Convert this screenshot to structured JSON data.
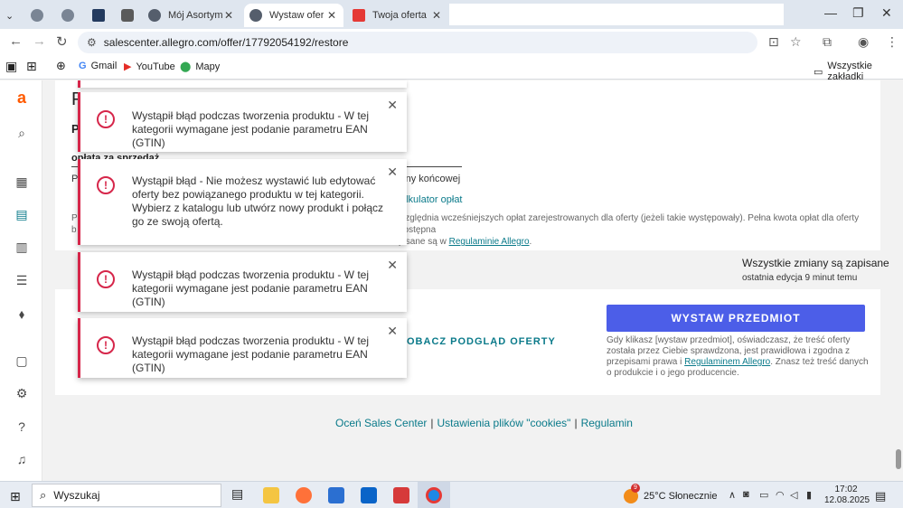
{
  "browser": {
    "tabs": [
      {
        "label": "",
        "icon": "globe-icon"
      },
      {
        "label": "",
        "icon": "globe-icon"
      },
      {
        "label": "",
        "icon": "video-icon"
      },
      {
        "label": "",
        "icon": "grey-square-icon"
      },
      {
        "label": "Mój Asortyment",
        "icon": "globe-icon"
      },
      {
        "label": "Wystaw ofertę",
        "icon": "globe-icon",
        "active": true
      },
      {
        "label": "Twoja oferta nie",
        "icon": "allegro-w-icon"
      }
    ],
    "url": "salescenter.allegro.com/offer/17792054192/restore",
    "bookmarks": [
      {
        "label": "Gmail",
        "icon": "google-icon"
      },
      {
        "label": "YouTube",
        "icon": "youtube-icon"
      },
      {
        "label": "Mapy",
        "icon": "maps-pin-icon"
      }
    ],
    "all_bookmarks": "Wszystkie zakładki"
  },
  "page": {
    "heading_fragment": "P",
    "subheading_fragment": "P",
    "fee_title": "opłata za sprzedaż",
    "fee_row_left": "P",
    "fee_row_text": "zeny końcowej",
    "fee_calc_link": "alkulator opłat",
    "fee_note_left": "P",
    "fee_note_left2": "b",
    "fee_note_line1": "względnia wcześniejszych opłat zarejestrowanych dla oferty (jeżeli takie występowały). Pełna kwota opłat dla oferty dostępna",
    "fee_note_line2_prefix": "pisane są w ",
    "fee_note_link": "Regulaminie Allegro",
    "fee_note_line2_suffix": ".",
    "saved_status": "Wszystkie zmiany są zapisane",
    "saved_sub": "ostatnia edycja 9 minut temu",
    "publish_button": "WYSTAW PRZEDMIOT",
    "publish_note_1": "Gdy klikasz [wystaw przedmiot], oświadczasz, że treść oferty została przez Ciebie sprawdzona, jest prawidłowa i zgodna z przepisami prawa i ",
    "publish_note_link": "Regulaminem Allegro",
    "publish_note_2": ". Znasz też treść danych o produkcie i o jego producencie.",
    "preview_link": "OBACZ PODGLĄD OFERTY",
    "footer": {
      "rate": "Oceń Sales Center",
      "cookies": "Ustawienia plików \"cookies\"",
      "rules": "Regulamin",
      "separator": "|"
    }
  },
  "toasts": [
    {
      "message": "Wystąpił błąd podczas tworzenia produktu - W tej kategorii wymagane jest podanie parametru EAN (GTIN)"
    },
    {
      "message": "Wystąpił błąd - Nie możesz wystawić lub edytować oferty bez powiązanego produktu w tej kategorii. Wybierz z katalogu lub utwórz nowy produkt i połącz go ze swoją ofertą."
    },
    {
      "message": "Wystąpił błąd podczas tworzenia produktu - W tej kategorii wymagane jest podanie parametru EAN (GTIN)"
    },
    {
      "message": "Wystąpił błąd podczas tworzenia produktu - W tej kategorii wymagane jest podanie parametru EAN (GTIN)"
    }
  ],
  "toast_icon_glyph": "!",
  "toast_close_glyph": "✕",
  "taskbar": {
    "search_placeholder": "Wyszukaj",
    "weather_badge": "9",
    "weather": "25°C  Słonecznie",
    "time": "17:02",
    "date": "12.08.2025"
  },
  "colors": {
    "accent": "#4c5ee8",
    "error": "#d6264a",
    "link": "#0a7a8a",
    "brand": "#ff5a00"
  }
}
